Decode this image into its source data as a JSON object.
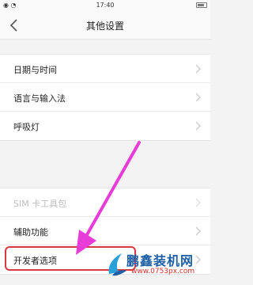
{
  "status_bar": {
    "left_icons": "◉ ◔",
    "time": "17:40"
  },
  "nav": {
    "title": "其他设置"
  },
  "settings": [
    {
      "label": "日期与时间"
    },
    {
      "label": "语言与输入法"
    },
    {
      "label": "呼吸灯"
    },
    {
      "label": "SIM 卡工具包"
    },
    {
      "label": "辅助功能"
    },
    {
      "label": "开发者选项"
    }
  ],
  "watermark": {
    "title": "鹏鑫装机网",
    "url": "www.0753px.com"
  },
  "colors": {
    "highlight": "#d8383f",
    "arrow": "#e83cd8",
    "watermark_blue": "#1e5fa6",
    "watermark_red": "#d3312b"
  }
}
